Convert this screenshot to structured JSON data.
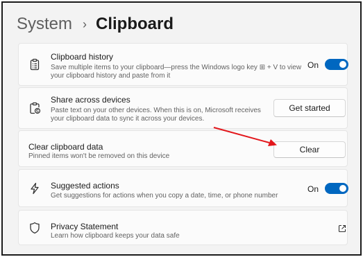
{
  "breadcrumb": {
    "parent": "System",
    "separator": "›",
    "current": "Clipboard"
  },
  "cards": {
    "history": {
      "title": "Clipboard history",
      "desc_line1": "Save multiple items to your clipboard—press the Windows logo key ⊞ + V to view",
      "desc_line2": "your clipboard history and paste from it",
      "toggle_label": "On",
      "toggle_on": true,
      "icon": "clipboard-list-icon"
    },
    "share": {
      "title": "Share across devices",
      "desc_line1": "Paste text on your other devices. When this is on, Microsoft receives",
      "desc_line2": "your clipboard data to sync it across your devices.",
      "button_label": "Get started",
      "icon": "clipboard-sync-icon"
    },
    "clear": {
      "title": "Clear clipboard data",
      "desc": "Pinned items won't be removed on this device",
      "button_label": "Clear"
    },
    "suggested": {
      "title": "Suggested actions",
      "desc": "Get suggestions for actions when you copy a date, time, or phone number",
      "toggle_label": "On",
      "toggle_on": true,
      "icon": "lightning-icon"
    },
    "privacy": {
      "title": "Privacy Statement",
      "desc": "Learn how clipboard keeps your data safe",
      "icon": "shield-icon",
      "link_icon": "external-link-icon"
    }
  },
  "colors": {
    "accent": "#0067c0",
    "annotation_arrow": "#e3161b"
  }
}
